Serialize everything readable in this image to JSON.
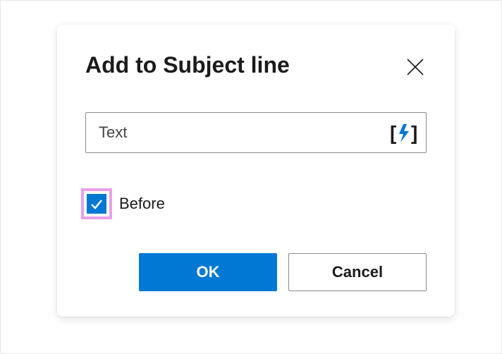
{
  "dialog": {
    "title": "Add to Subject line",
    "text_field": {
      "placeholder": "Text",
      "value": ""
    },
    "checkbox": {
      "label": "Before",
      "checked": true
    },
    "buttons": {
      "ok": "OK",
      "cancel": "Cancel"
    }
  },
  "colors": {
    "primary": "#0078d4",
    "highlight": "#e9a0e9"
  }
}
